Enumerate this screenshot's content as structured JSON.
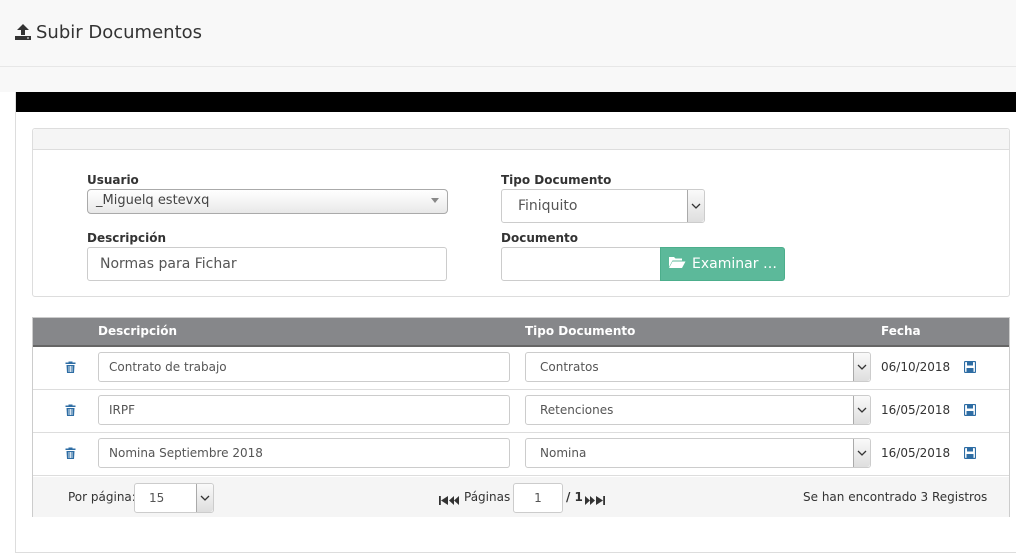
{
  "header": {
    "title": "Subir Documentos",
    "icon": "upload-icon"
  },
  "form": {
    "usuario_label": "Usuario",
    "usuario_value": "_Miguelq estevxq",
    "tipo_label": "Tipo Documento",
    "tipo_value": "Finiquito",
    "descripcion_label": "Descripción",
    "descripcion_value": "Normas para Fichar",
    "documento_label": "Documento",
    "documento_value": "",
    "browse_label": "Examinar …",
    "browse_color": "#5cb99a"
  },
  "table": {
    "columns": [
      "Descripción",
      "Tipo Documento",
      "Fecha"
    ],
    "header_color": "#86878a",
    "rows": [
      {
        "descripcion": "Contrato de trabajo",
        "tipo": "Contratos",
        "fecha": "06/10/2018"
      },
      {
        "descripcion": "IRPF",
        "tipo": "Retenciones",
        "fecha": "16/05/2018"
      },
      {
        "descripcion": "Nomina Septiembre 2018",
        "tipo": "Nomina",
        "fecha": "16/05/2018"
      }
    ]
  },
  "pagination": {
    "per_page_label": "Por página:",
    "per_page_value": "15",
    "pages_label": "Páginas",
    "current_page": "1",
    "total_pages": "/ 1",
    "records_text": "Se han encontrado 3 Registros"
  }
}
